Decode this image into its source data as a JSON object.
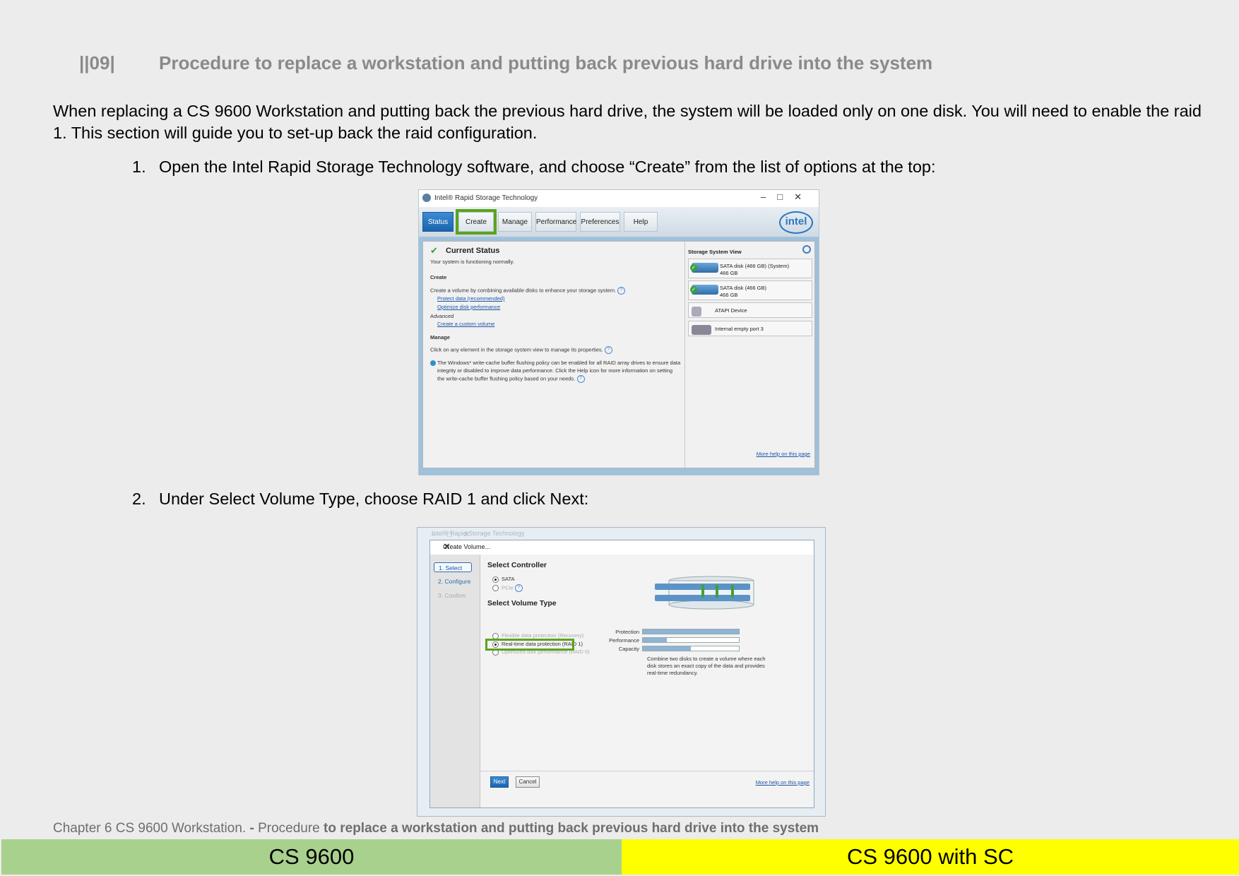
{
  "header": {
    "section_number": "||09|",
    "title": "Procedure to replace a workstation and putting back previous hard drive into the system"
  },
  "intro": "When replacing a CS 9600 Workstation and putting back the previous hard drive, the system will be loaded only on one disk. You will need to enable the raid 1. This section will guide you to set-up back the raid configuration.",
  "steps": [
    {
      "num": "1.",
      "text": "Open the Intel Rapid Storage Technology software, and choose “Create” from the list of options at the top:"
    },
    {
      "num": "2.",
      "text": "Under Select Volume Type, choose RAID 1 and click Next:"
    }
  ],
  "screenshot1": {
    "window_title": "Intel® Rapid Storage Technology",
    "tabs": [
      "Status",
      "Create",
      "Manage",
      "Performance",
      "Preferences",
      "Help"
    ],
    "logo": "intel",
    "current_status": "Current Status",
    "status_text": "Your system is functioning normally.",
    "create_heading": "Create",
    "create_text": "Create a volume by combining available disks to enhance your storage system.",
    "link_protect": "Protect data (recommended)",
    "link_optimize": "Optimize disk performance",
    "advanced_label": "Advanced",
    "link_custom": "Create a custom volume",
    "manage_heading": "Manage",
    "manage_text": "Click on any element in the storage system view to manage its properties.",
    "info_line1": "The Windows* write-cache buffer flushing policy can be enabled for all RAID array drives to ensure data",
    "info_line2": "integrity or disabled to improve data performance. Click the Help icon for more information on setting",
    "info_line3": "the write-cache buffer flushing policy based on your needs.",
    "storage_view_title": "Storage System View",
    "disks": [
      {
        "name": "SATA disk (466 GB) (System)",
        "size": "466 GB"
      },
      {
        "name": "SATA disk (466 GB)",
        "size": "466 GB"
      },
      {
        "name": "ATAPI Device",
        "size": ""
      },
      {
        "name": "Internal empty port 3",
        "size": ""
      }
    ],
    "more_help": "More help on this page"
  },
  "screenshot2": {
    "bg_window_title": "Intel® Rapid Storage Technology",
    "dialog_title": "Create Volume...",
    "side_steps": [
      "1. Select",
      "2. Configure",
      "3. Confirm"
    ],
    "select_controller": "Select Controller",
    "controller_options": [
      "SATA",
      "PCIe"
    ],
    "select_volume_type": "Select Volume Type",
    "volume_options": [
      "Flexible data protection (Recovery)",
      "Real-time data protection (RAID 1)",
      "Optimized disk performance (RAID 0)"
    ],
    "meters": [
      {
        "label": "Protection",
        "level": 1.0
      },
      {
        "label": "Performance",
        "level": 0.25
      },
      {
        "label": "Capacity",
        "level": 0.5
      }
    ],
    "description": "Combine two disks to create a volume where each disk stores an exact copy of the data and provides real-time redundancy.",
    "next_button": "Next",
    "cancel_button": "Cancel",
    "more_help": "More help on this page"
  },
  "footer": {
    "chapter": "Chapter 6 CS 9600 Workstation.",
    "sep": " - ",
    "procedure_word": "Procedure ",
    "rest": "to replace a workstation and putting back previous hard drive into the system"
  },
  "bottom_bar": {
    "left": "CS 9600",
    "right": "CS 9600 with SC",
    "left_color": "#a9d18e",
    "right_color": "#ffff00"
  }
}
